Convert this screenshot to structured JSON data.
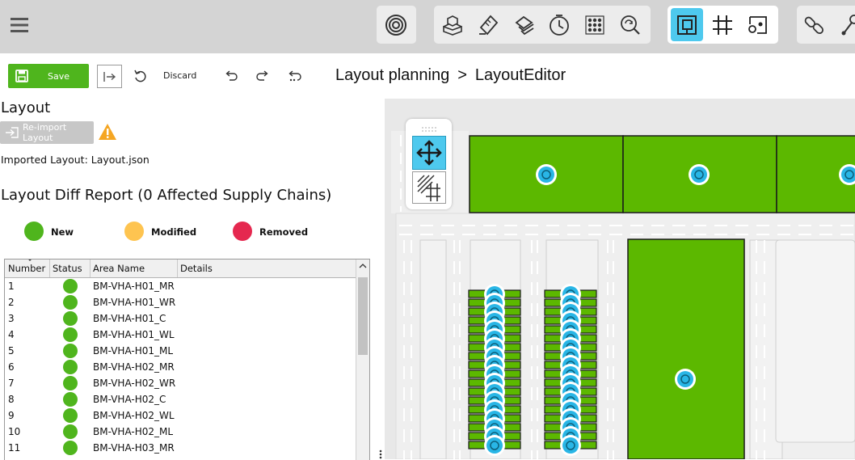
{
  "toolbar": {
    "menu_icon": "hamburger-menu-icon",
    "groups": [
      {
        "name": "view",
        "icons": [
          "radar-target-icon"
        ]
      },
      {
        "name": "objects",
        "icons": [
          "cubes-icon",
          "ruler-pencil-icon",
          "layers-icon",
          "clock-icon",
          "dot-grid-icon",
          "search-refresh-icon"
        ]
      },
      {
        "name": "mode",
        "icons": [
          "area-select-icon",
          "grid-icon",
          "node-path-icon"
        ],
        "active": "area-select-icon"
      },
      {
        "name": "links",
        "icons": [
          "chain-link-icon",
          "route-icon"
        ]
      }
    ],
    "accent": "#4ec9ee"
  },
  "actions": {
    "save_label": "Save",
    "discard_label": "Discard",
    "save_color": "#4fb51d"
  },
  "breadcrumb": {
    "parent": "Layout planning",
    "separator": ">",
    "current": "LayoutEditor"
  },
  "layout_panel": {
    "title": "Layout",
    "reimport_label": "Re-import Layout",
    "imported_text": "Imported Layout: Layout.json"
  },
  "diff_report": {
    "title": "Layout Diff Report (0 Affected Supply Chains)",
    "legend": [
      {
        "label": "New",
        "color": "#4fb51d"
      },
      {
        "label": "Modified",
        "color": "#fec450"
      },
      {
        "label": "Removed",
        "color": "#e5284f"
      }
    ],
    "columns": [
      "Number",
      "Status",
      "Area Name",
      "Details"
    ],
    "rows": [
      {
        "number": "1",
        "status": "new",
        "area": "BM-VHA-H01_MR",
        "details": ""
      },
      {
        "number": "2",
        "status": "new",
        "area": "BM-VHA-H01_WR",
        "details": ""
      },
      {
        "number": "3",
        "status": "new",
        "area": "BM-VHA-H01_C",
        "details": ""
      },
      {
        "number": "4",
        "status": "new",
        "area": "BM-VHA-H01_WL",
        "details": ""
      },
      {
        "number": "5",
        "status": "new",
        "area": "BM-VHA-H01_ML",
        "details": ""
      },
      {
        "number": "6",
        "status": "new",
        "area": "BM-VHA-H02_MR",
        "details": ""
      },
      {
        "number": "7",
        "status": "new",
        "area": "BM-VHA-H02_WR",
        "details": ""
      },
      {
        "number": "8",
        "status": "new",
        "area": "BM-VHA-H02_C",
        "details": ""
      },
      {
        "number": "9",
        "status": "new",
        "area": "BM-VHA-H02_WL",
        "details": ""
      },
      {
        "number": "10",
        "status": "new",
        "area": "BM-VHA-H02_ML",
        "details": ""
      },
      {
        "number": "11",
        "status": "new",
        "area": "BM-VHA-H03_MR",
        "details": ""
      }
    ]
  },
  "canvas": {
    "area_color": "#5cb800",
    "node_color": "#29b6e6",
    "tools": [
      "move-icon",
      "grid-snap-icon"
    ],
    "active_tool": "move-icon"
  }
}
